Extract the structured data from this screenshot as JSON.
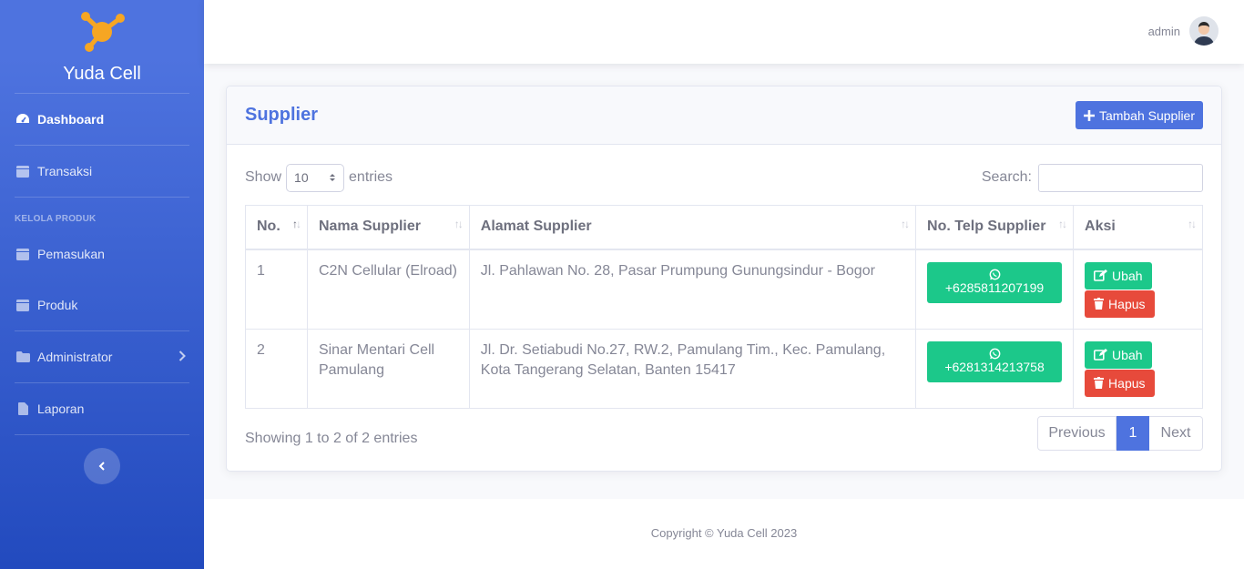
{
  "brand": {
    "name": "Yuda Cell",
    "logo": "molecule-logo"
  },
  "sidebar": {
    "items": [
      {
        "label": "Dashboard",
        "icon": "tachometer-icon"
      },
      {
        "label": "Transaksi",
        "icon": "table-icon"
      },
      {
        "label": "Pemasukan",
        "icon": "table-icon"
      },
      {
        "label": "Produk",
        "icon": "table-icon"
      },
      {
        "label": "Administrator",
        "icon": "folder-icon"
      },
      {
        "label": "Laporan",
        "icon": "file-icon"
      }
    ],
    "heading": "KELOLA PRODUK"
  },
  "topbar": {
    "username": "admin"
  },
  "page": {
    "title": "Supplier",
    "add_button": "Tambah Supplier"
  },
  "table_controls": {
    "show_label": "Show",
    "entries_value": "10",
    "entries_label": "entries",
    "search_label": "Search:",
    "search_value": ""
  },
  "table": {
    "headers": [
      "No.",
      "Nama Supplier",
      "Alamat Supplier",
      "No. Telp Supplier",
      "Aksi"
    ],
    "rows": [
      {
        "no": "1",
        "nama": "C2N Cellular (Elroad)",
        "alamat": "Jl. Pahlawan No. 28, Pasar Prumpung Gunungsindur - Bogor",
        "telp": "+6285811207199"
      },
      {
        "no": "2",
        "nama": "Sinar Mentari Cell Pamulang",
        "alamat": "Jl. Dr. Setiabudi No.27, RW.2, Pamulang Tim., Kec. Pamulang, Kota Tangerang Selatan, Banten 15417",
        "telp": "+6281314213758"
      }
    ],
    "edit_label": "Ubah",
    "delete_label": "Hapus"
  },
  "pagination": {
    "info": "Showing 1 to 2 of 2 entries",
    "previous": "Previous",
    "current": "1",
    "next": "Next"
  },
  "footer": {
    "copyright": "Copyright © Yuda Cell 2023"
  },
  "colors": {
    "primary": "#4e73df",
    "success": "#1cc88a",
    "danger": "#e74a3b"
  }
}
